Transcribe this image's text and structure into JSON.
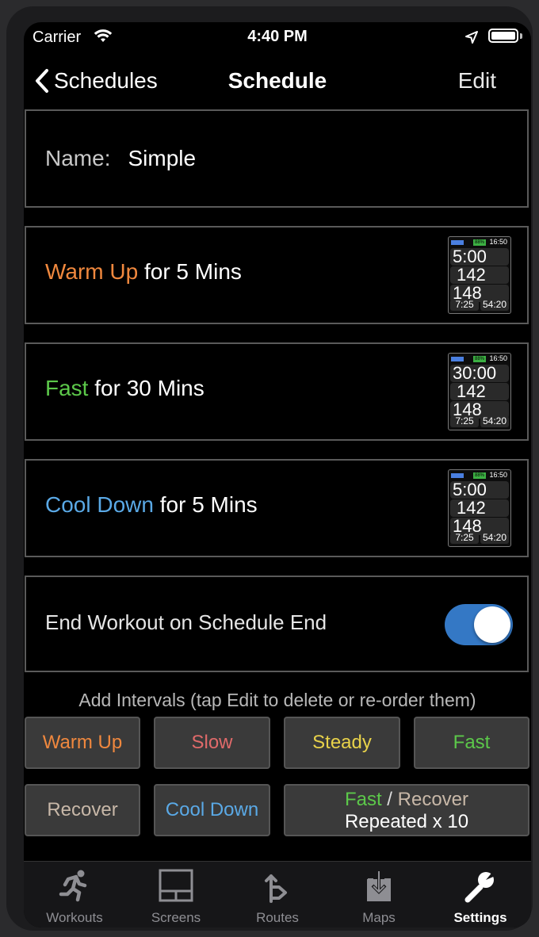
{
  "status_bar": {
    "carrier": "Carrier",
    "time": "4:40 PM"
  },
  "nav": {
    "back_label": "Schedules",
    "title": "Schedule",
    "edit_label": "Edit"
  },
  "name_cell": {
    "label": "Name:",
    "value": "Simple"
  },
  "intervals": [
    {
      "name": "Warm Up",
      "detail": " for 5 Mins",
      "color": "#f0883e",
      "preview": {
        "time": "5:00",
        "hr": "142",
        "avg": "148",
        "pace": "7:25",
        "elapsed": "54:20",
        "battery": "88%",
        "clock": "16:50"
      }
    },
    {
      "name": "Fast",
      "detail": " for 30 Mins",
      "color": "#5cc84a",
      "preview": {
        "time": "30:00",
        "hr": "142",
        "avg": "148",
        "pace": "7:25",
        "elapsed": "54:20",
        "battery": "88%",
        "clock": "16:50"
      }
    },
    {
      "name": "Cool Down",
      "detail": " for 5 Mins",
      "color": "#5aa9e6",
      "preview": {
        "time": "5:00",
        "hr": "142",
        "avg": "148",
        "pace": "7:25",
        "elapsed": "54:20",
        "battery": "88%",
        "clock": "16:50"
      }
    }
  ],
  "end_workout": {
    "label": "End Workout on Schedule End",
    "enabled": true
  },
  "add_intervals": {
    "hint": "Add Intervals (tap Edit to delete or re-order them)",
    "buttons": [
      {
        "label": "Warm Up",
        "color": "#f0883e"
      },
      {
        "label": "Slow",
        "color": "#e06a6a"
      },
      {
        "label": "Steady",
        "color": "#e8d24a"
      },
      {
        "label": "Fast",
        "color": "#5cc84a"
      },
      {
        "label": "Recover",
        "color": "#c8b8a8"
      },
      {
        "label": "Cool Down",
        "color": "#5aa9e6"
      }
    ],
    "repeat_button": {
      "part1": "Fast",
      "separator": " / ",
      "part2": "Recover",
      "line2": "Repeated x 10"
    }
  },
  "tabs": [
    {
      "label": "Workouts",
      "icon": "runner-icon",
      "active": false
    },
    {
      "label": "Screens",
      "icon": "screens-icon",
      "active": false
    },
    {
      "label": "Routes",
      "icon": "routes-icon",
      "active": false
    },
    {
      "label": "Maps",
      "icon": "maps-download-icon",
      "active": false
    },
    {
      "label": "Settings",
      "icon": "wrench-icon",
      "active": true
    }
  ]
}
